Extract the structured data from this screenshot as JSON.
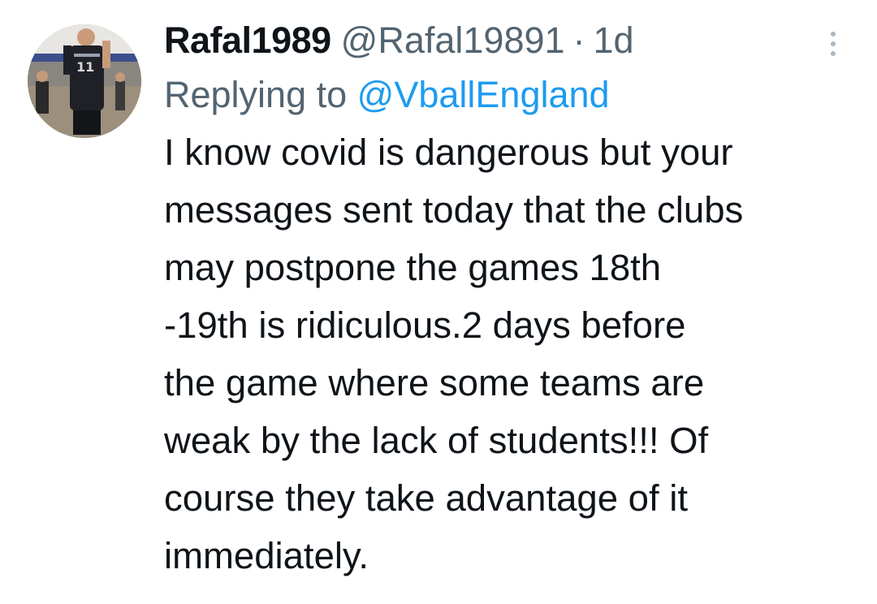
{
  "tweet": {
    "display_name": "Rafal1989",
    "handle": "@Rafal19891",
    "separator": "·",
    "time": "1d",
    "reply_prefix": "Replying to",
    "reply_to": "@VballEngland",
    "text": "I know covid is dangerous but your\nmessages sent today that the clubs\nmay postpone the games 18th\n-19th is ridiculous.2 days before\nthe game where some teams are\nweak by the lack of students!!! Of\ncourse they take advantage of it\nimmediately.",
    "avatar_icon": "avatar-volleyball-player",
    "more_icon": "more-vertical-icon"
  },
  "colors": {
    "text_primary": "#0f1419",
    "text_secondary": "#536471",
    "link": "#1d9bf0",
    "background": "#ffffff"
  }
}
